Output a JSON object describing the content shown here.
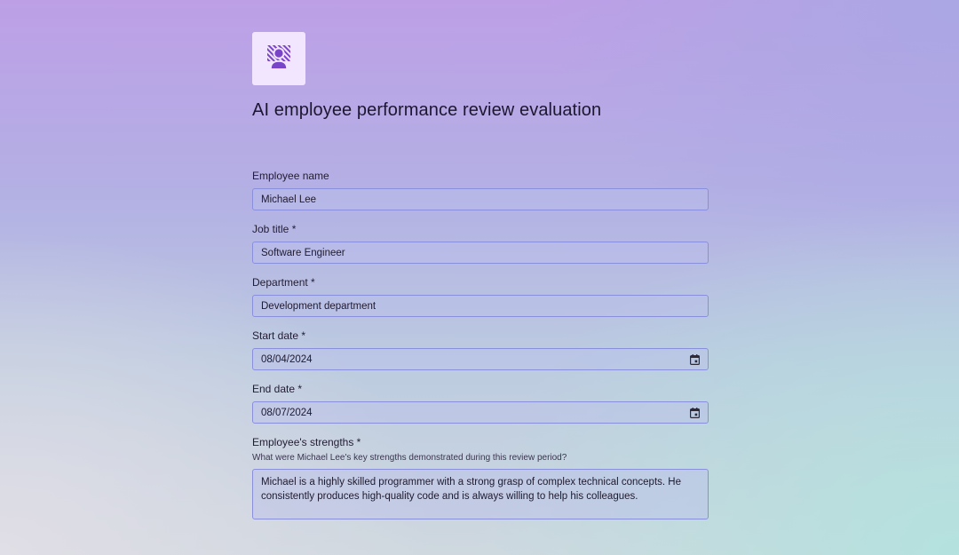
{
  "header": {
    "logo_icon": "employee-badge-icon",
    "title": "AI employee performance review evaluation"
  },
  "colors": {
    "accent": "#7a44c9",
    "logo_tile_bg": "#f1e6fd",
    "field_border": "#8a8fdc"
  },
  "form": {
    "employee_name": {
      "label": "Employee name",
      "value": "Michael Lee"
    },
    "job_title": {
      "label": "Job title *",
      "value": "Software Engineer"
    },
    "department": {
      "label": "Department *",
      "value": "Development department"
    },
    "start_date": {
      "label": "Start date *",
      "value": "08/04/2024",
      "icon": "calendar-icon"
    },
    "end_date": {
      "label": "End date *",
      "value": "08/07/2024",
      "icon": "calendar-icon"
    },
    "strengths": {
      "label": "Employee's strengths *",
      "help": "What were Michael Lee's key strengths demonstrated during this review period?",
      "value": "Michael is a highly skilled programmer with a strong grasp of complex technical concepts. He consistently produces high-quality code and is always willing to help his colleagues."
    }
  }
}
